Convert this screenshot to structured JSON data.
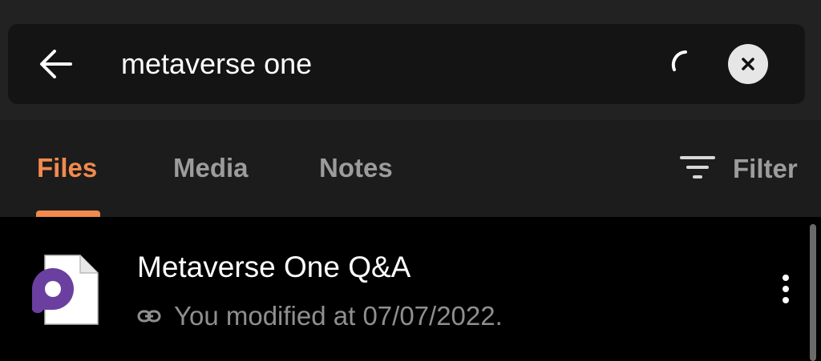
{
  "search": {
    "query": "metaverse one"
  },
  "tabs": [
    {
      "label": "Files",
      "active": true
    },
    {
      "label": "Media",
      "active": false
    },
    {
      "label": "Notes",
      "active": false
    }
  ],
  "filter": {
    "label": "Filter"
  },
  "results": [
    {
      "title": "Metaverse One Q&A",
      "meta": "You modified at 07/07/2022.",
      "icon": "document-icon"
    }
  ],
  "colors": {
    "accent": "#f28a4d",
    "brand_purple": "#6b3fa0",
    "background": "#000000",
    "header": "#222222"
  },
  "icons": {
    "back": "back-arrow-icon",
    "spinner": "loading-spinner-icon",
    "clear": "clear-icon",
    "filter": "filter-icon",
    "link": "link-icon",
    "more": "more-vertical-icon"
  }
}
